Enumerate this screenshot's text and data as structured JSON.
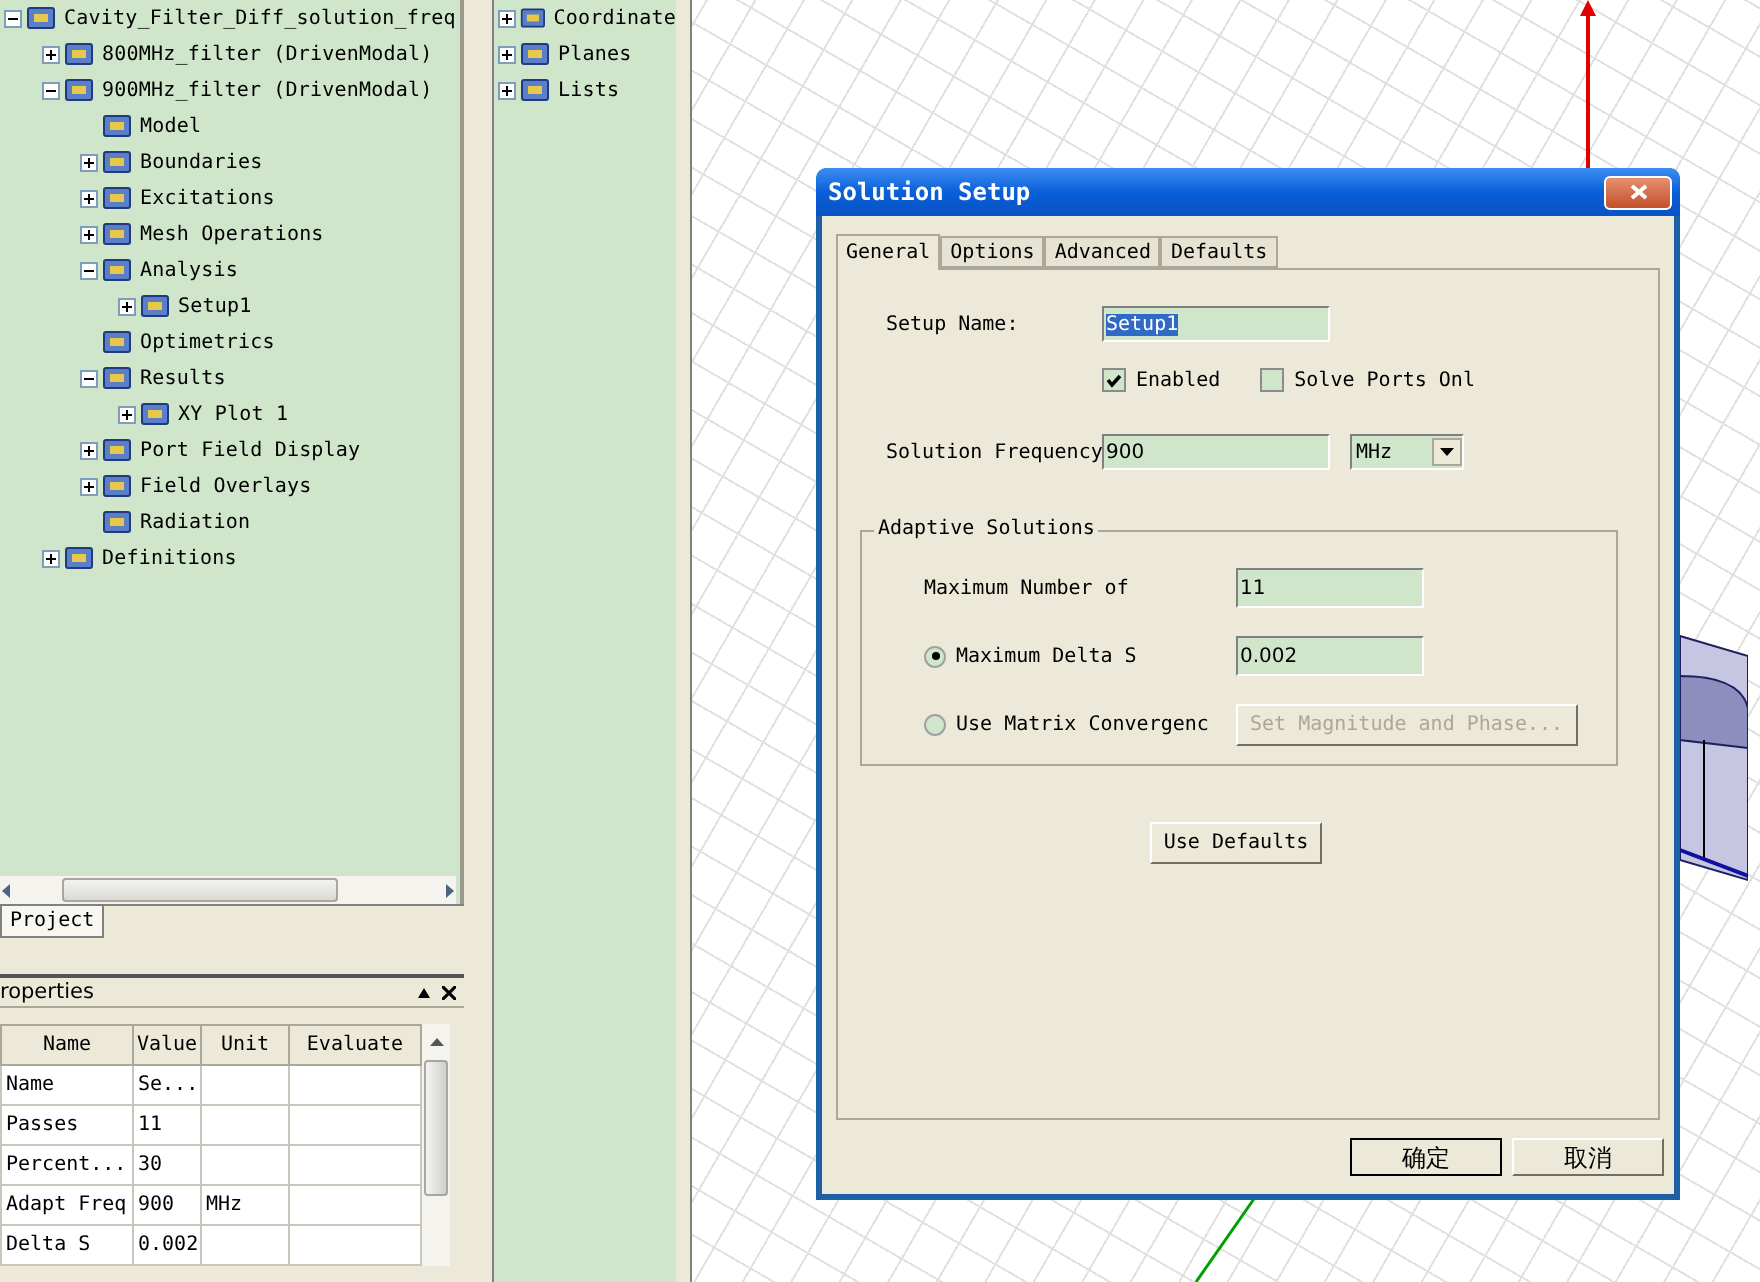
{
  "project_tree": {
    "nodes": [
      {
        "label": "Cavity_Filter_Diff_solution_freq",
        "expandable": true,
        "expanded": true,
        "children": [
          {
            "label": "800MHz_filter (DrivenModal)",
            "expandable": true,
            "expanded": false
          },
          {
            "label": "900MHz_filter (DrivenModal)",
            "expandable": true,
            "expanded": true,
            "children": [
              {
                "label": "Model",
                "expandable": false
              },
              {
                "label": "Boundaries",
                "expandable": true,
                "expanded": false
              },
              {
                "label": "Excitations",
                "expandable": true,
                "expanded": false
              },
              {
                "label": "Mesh Operations",
                "expandable": true,
                "expanded": false
              },
              {
                "label": "Analysis",
                "expandable": true,
                "expanded": true,
                "children": [
                  {
                    "label": "Setup1",
                    "expandable": true,
                    "expanded": false
                  }
                ]
              },
              {
                "label": "Optimetrics",
                "expandable": false
              },
              {
                "label": "Results",
                "expandable": true,
                "expanded": true,
                "children": [
                  {
                    "label": "XY Plot 1",
                    "expandable": true,
                    "expanded": false
                  }
                ]
              },
              {
                "label": "Port Field Display",
                "expandable": true,
                "expanded": false
              },
              {
                "label": "Field Overlays",
                "expandable": true,
                "expanded": false
              },
              {
                "label": "Radiation",
                "expandable": false
              }
            ]
          },
          {
            "label": "Definitions",
            "expandable": true,
            "expanded": false
          }
        ]
      }
    ]
  },
  "project_tabs": [
    {
      "label": "Project",
      "selected": true
    }
  ],
  "properties_panel": {
    "title": "roperties",
    "columns": [
      "Name",
      "Value",
      "Unit",
      "Evaluate"
    ],
    "rows": [
      {
        "name": "Name",
        "value": "Se..."
      },
      {
        "name": "Passes",
        "value": "11"
      },
      {
        "name": "Percent...",
        "value": "30"
      },
      {
        "name": "Adapt Freq",
        "value": "900",
        "unit": "MHz"
      },
      {
        "name": "Delta S",
        "value": "0.002"
      }
    ]
  },
  "definitions_tree": {
    "nodes": [
      {
        "label": "Coordinate",
        "expandable": true,
        "expanded": false
      },
      {
        "label": "Planes",
        "expandable": true,
        "expanded": false
      },
      {
        "label": "Lists",
        "expandable": true,
        "expanded": false
      }
    ]
  },
  "dialog": {
    "title": "Solution Setup",
    "tabs": [
      {
        "label": "General",
        "selected": true
      },
      {
        "label": "Options",
        "selected": false
      },
      {
        "label": "Advanced",
        "selected": false
      },
      {
        "label": "Defaults",
        "selected": false
      }
    ],
    "setup_name": {
      "label": "Setup Name:",
      "value": "Setup1",
      "text_selected": true
    },
    "checkboxes": [
      {
        "label": "Enabled",
        "checked": true
      },
      {
        "label": "Solve Ports Onl",
        "checked": false
      }
    ],
    "solution_frequency": {
      "label": "Solution Frequency",
      "value": "900",
      "unit": "MHz"
    },
    "adaptive_solutions": {
      "title": "Adaptive Solutions",
      "max_passes": {
        "label": "Maximum Number of",
        "value": "11"
      },
      "options": [
        {
          "kind": "field",
          "label": "Maximum Delta S",
          "selected": true,
          "value": "0.002"
        },
        {
          "kind": "button",
          "label": "Use Matrix Convergenc",
          "selected": false,
          "button": {
            "label": "Set Magnitude and Phase...",
            "disabled": true
          }
        }
      ]
    },
    "use_defaults_button": "Use Defaults",
    "buttons": [
      "确定",
      "取消"
    ]
  }
}
